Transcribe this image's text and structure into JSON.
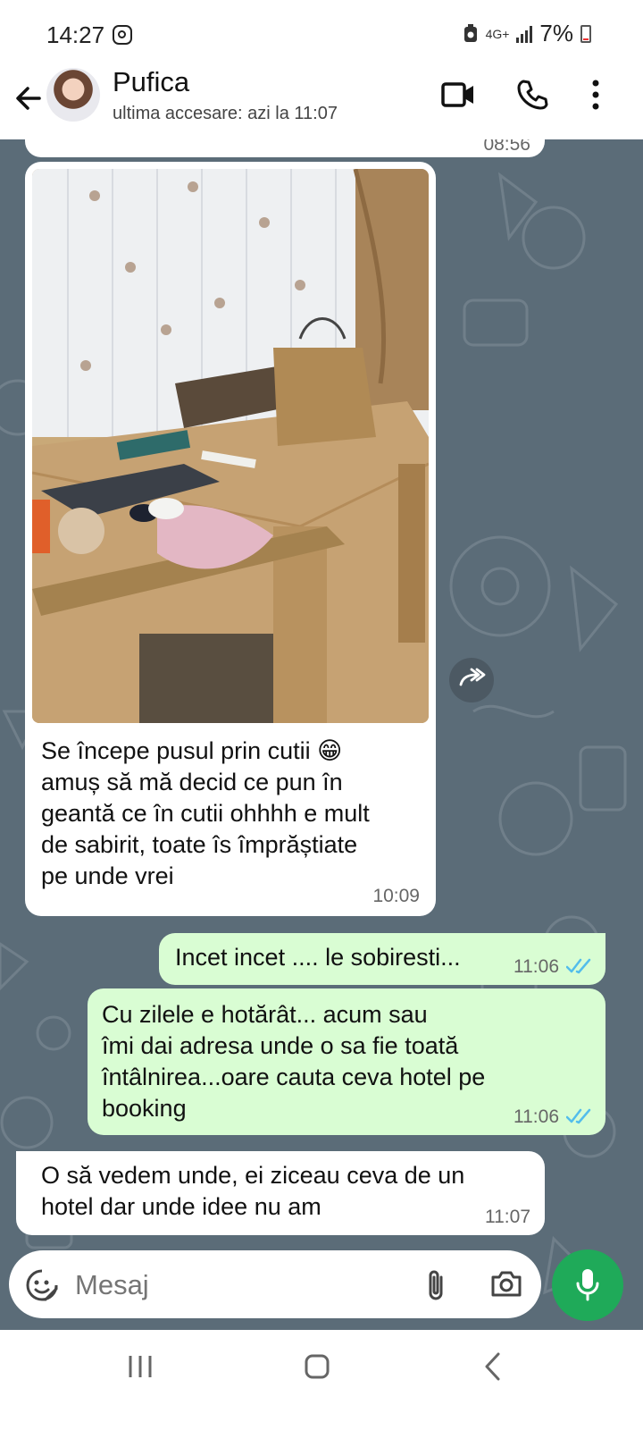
{
  "status_bar": {
    "time": "14:27",
    "network": "4G+",
    "battery": "7%"
  },
  "header": {
    "contact_name": "Pufica",
    "last_seen": "ultima accesare: azi la 11:07"
  },
  "messages": [
    {
      "direction": "in",
      "partial": true,
      "time": "08:56"
    },
    {
      "direction": "in",
      "has_image": true,
      "image_description": "photo",
      "text": "Se începe pusul prin cutii 😁\namuș să mă decid ce pun în\ngeantă ce în cutii ohhhh e mult\nde sabirit, toate îs împrăștiate\npe unde vrei",
      "time": "10:09"
    },
    {
      "direction": "out",
      "text": "Incet incet  .... le sobiresti...",
      "time": "11:06",
      "status": "read"
    },
    {
      "direction": "out",
      "text": "Cu zilele e hotărât... acum sau\nîmi dai adresa unde o sa fie toată\nîntâlnirea...oare cauta ceva hotel  pe\nbooking",
      "time": "11:06",
      "status": "read"
    },
    {
      "direction": "in",
      "text": "O să vedem unde, ei ziceau ceva de un\nhotel dar unde idee nu am",
      "time": "11:07"
    }
  ],
  "composer": {
    "placeholder": "Mesaj",
    "icons": [
      "emoji-sticker-icon",
      "attach-icon",
      "camera-icon",
      "mic-icon"
    ]
  },
  "colors": {
    "chat_bg": "#5b6c78",
    "outgoing_bubble": "#d9fdd3",
    "incoming_bubble": "#ffffff",
    "read_tick": "#53bdeb",
    "mic_button": "#1faa59"
  }
}
